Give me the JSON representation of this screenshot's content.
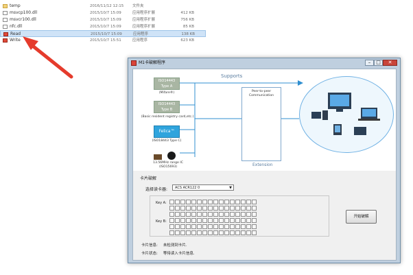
{
  "files": [
    {
      "name": "temp",
      "date": "2016/11/12 12:15",
      "type": "文件夹",
      "size": "",
      "icon": "folder-icon",
      "selected": false
    },
    {
      "name": "msvcp100.dll",
      "date": "2015/10/7 15:09",
      "type": "应用程序扩展",
      "size": "412 KB",
      "icon": "dll-file-icon",
      "selected": false
    },
    {
      "name": "msvcr100.dll",
      "date": "2015/10/7 15:09",
      "type": "应用程序扩展",
      "size": "756 KB",
      "icon": "dll-file-icon",
      "selected": false
    },
    {
      "name": "nfc.dll",
      "date": "2015/10/7 15:09",
      "type": "应用程序扩展",
      "size": "85 KB",
      "icon": "dll-file-icon",
      "selected": false
    },
    {
      "name": "Read",
      "date": "2015/10/7 15:09",
      "type": "应用程序",
      "size": "138 KB",
      "icon": "app-icon",
      "selected": true
    },
    {
      "name": "Write",
      "date": "2015/10/7 15:51",
      "type": "应用程序",
      "size": "623 KB",
      "icon": "app-icon",
      "selected": false
    }
  ],
  "dialog": {
    "title": "M1卡破解程序",
    "min_label": "–",
    "max_label": "□",
    "close_label": "✕",
    "banner": {
      "supports": "Supports",
      "cards": [
        {
          "line1": "ISO14443",
          "line2": "Type A",
          "caption": "(Mifare®)",
          "style": "gray"
        },
        {
          "line1": "ISO14443",
          "line2": "Type B",
          "caption": "(Basic resident registry card,etc.)",
          "style": "gray"
        },
        {
          "line1": "Felica™",
          "line2": "",
          "caption": "(ISO18443 Type C)",
          "style": "blue"
        }
      ],
      "ic_caption_1": "13.56MHz range IC",
      "ic_caption_2": "(ISO15693)",
      "peer_label_1": "Peer-to-peer",
      "peer_label_2": "Communication",
      "extension": "Extension"
    },
    "group_title": "卡片破解",
    "reader_label": "选择读卡器:",
    "reader_value": "ACS ACR122 0",
    "reader_caret": "▼",
    "key_a_label": "Key A:",
    "key_b_label": "Key B:",
    "start_button": "开始破解",
    "card_info_label": "卡片信息:",
    "card_info_value": "未检测到卡片.",
    "card_status_label": "卡片状态:",
    "card_status_value": "等待读入卡片信息."
  },
  "colors": {
    "annotation_arrow": "#e53b2c",
    "selection": "#cfe3f7",
    "felica": "#2fa4dd"
  }
}
